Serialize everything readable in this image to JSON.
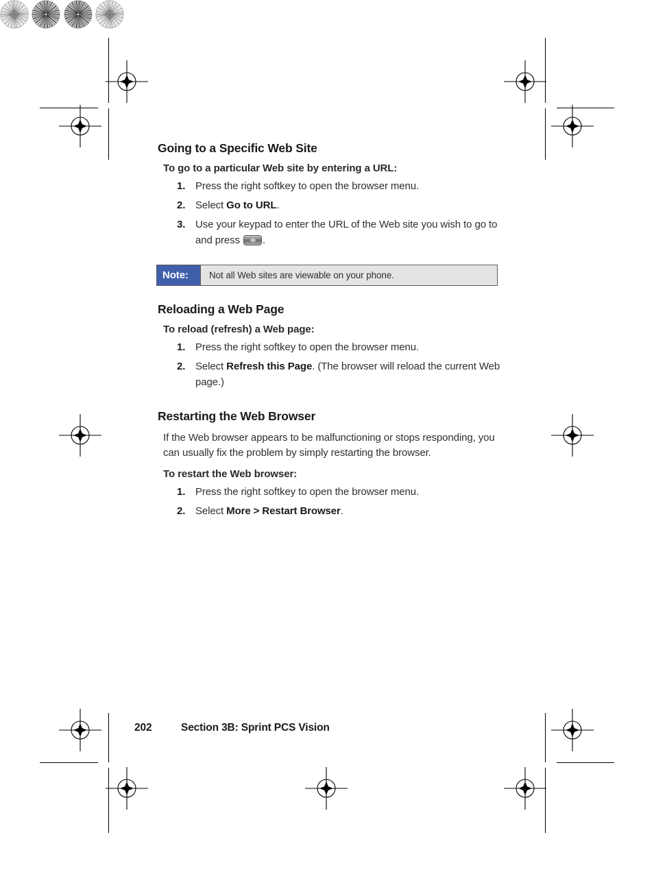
{
  "document": {
    "page_number": "202",
    "section_footer": "Section 3B: Sprint PCS Vision"
  },
  "sections": [
    {
      "heading": "Going to a Specific Web Site",
      "lead": "To go to a particular Web site by entering a URL:",
      "steps": [
        {
          "num": "1.",
          "text": "Press the right softkey to open the browser menu."
        },
        {
          "num": "2.",
          "pre": "Select ",
          "bold": "Go to URL",
          "post": "."
        },
        {
          "num": "3.",
          "pre": "Use your keypad to enter the URL of the Web site you wish to go to and press ",
          "icon": "phone-ok-key-icon",
          "post": "."
        }
      ]
    },
    {
      "heading": "Reloading a Web Page",
      "lead": "To reload (refresh) a Web page:",
      "steps": [
        {
          "num": "1.",
          "text": "Press the right softkey to open the browser menu."
        },
        {
          "num": "2.",
          "pre": "Select ",
          "bold": "Refresh this Page",
          "post": ". (The browser will reload the current Web page.)"
        }
      ]
    },
    {
      "heading": "Restarting the Web Browser",
      "paragraph": "If the Web browser appears to be malfunctioning or stops responding, you can usually fix the problem by simply restarting the browser.",
      "lead": "To restart the Web browser:",
      "steps": [
        {
          "num": "1.",
          "text": "Press the right softkey to open the browser menu."
        },
        {
          "num": "2.",
          "pre": "Select ",
          "bold": "More > Restart Browser",
          "post": "."
        }
      ]
    }
  ],
  "note": {
    "label": "Note:",
    "text": "Not all Web sites are viewable on your phone.",
    "label_color": "#3f5fab",
    "body_color": "#e4e4e4",
    "border_color": "#5c5c5c"
  },
  "printer_marks": {
    "registration_icon": "registration-target-icon",
    "star_icon": "star-target-icon",
    "crop_line_icon": "crop-line-icon"
  }
}
